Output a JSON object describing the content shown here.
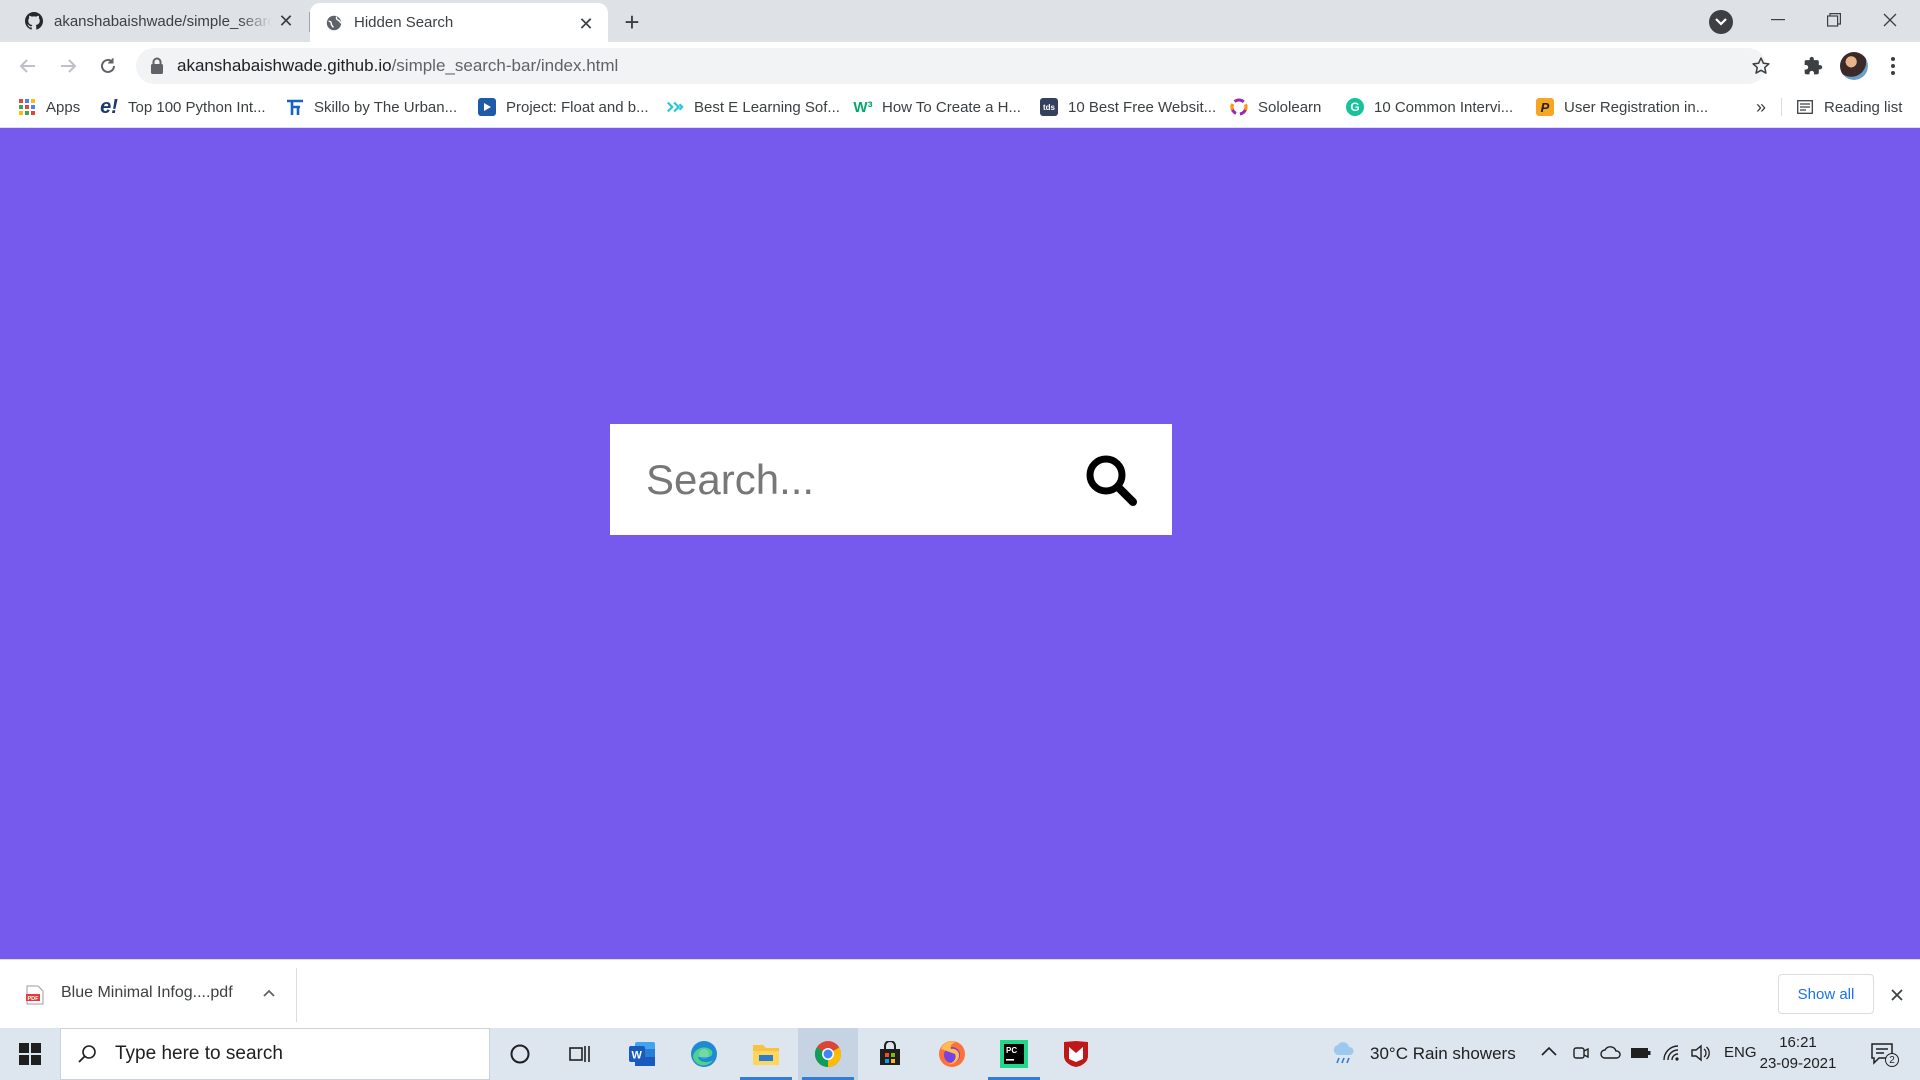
{
  "browser": {
    "tabs": [
      {
        "title": "akanshabaishwade/simple_search-bar",
        "favicon": "github-icon",
        "active": false
      },
      {
        "title": "Hidden Search",
        "favicon": "globe-icon",
        "active": true
      }
    ],
    "url_host": "akanshabaishwade.github.io",
    "url_path": "/simple_search-bar/index.html",
    "bookmarks": [
      {
        "label": "Apps",
        "icon": "apps-grid-icon"
      },
      {
        "label": "Top 100 Python Int...",
        "icon": "edureka-icon"
      },
      {
        "label": "Skillo by The Urban...",
        "icon": "skillo-icon"
      },
      {
        "label": "Project: Float and b...",
        "icon": "play-icon"
      },
      {
        "label": "Best E Learning Sof...",
        "icon": "elearning-icon"
      },
      {
        "label": "How To Create a H...",
        "icon": "w3-icon"
      },
      {
        "label": "10 Best Free Websit...",
        "icon": "tds-icon"
      },
      {
        "label": "Sololearn",
        "icon": "sololearn-icon"
      },
      {
        "label": "10 Common Intervi...",
        "icon": "grammarly-icon"
      },
      {
        "label": "User Registration in...",
        "icon": "p-icon"
      }
    ],
    "bookmarks_overflow": "»",
    "reading_list": "Reading list"
  },
  "page": {
    "search_placeholder": "Search...",
    "background_color": "#765aee"
  },
  "downloads": {
    "file_name": "Blue Minimal Infog....pdf",
    "show_all": "Show all"
  },
  "taskbar": {
    "search_placeholder": "Type here to search",
    "weather": "30°C  Rain showers",
    "language": "ENG",
    "time": "16:21",
    "date": "23-09-2021",
    "notification_count": "2"
  }
}
